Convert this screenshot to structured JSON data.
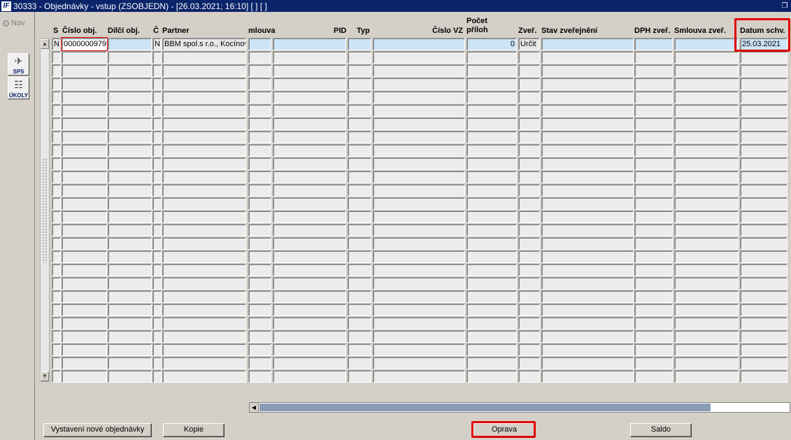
{
  "window": {
    "title": "30333 - Objednávky - vstup (ZSOBJEDN) - [26.03.2021; 16:10]  [ ]  [ ]",
    "app_icon": "IF"
  },
  "left": {
    "nav_label": "Nav",
    "tool_sps": "SPS",
    "tool_ukoly": "ÚKOLY"
  },
  "columns": {
    "s": "S",
    "cislo_obj": "Číslo obj.",
    "dilci_obj": "Dílčí obj.",
    "c": "Č",
    "partner": "Partner",
    "smlouva": "mlouva",
    "pid": "PID",
    "typ": "Typ",
    "cislo_vz": "Číslo VZ",
    "pocet_l1": "Počet",
    "pocet_l2": "příloh",
    "zver": "Zveř.",
    "stav": "Stav zveřejnění",
    "dph": "DPH zveř.",
    "smlouva_zver": "Smlouva zveř.",
    "datum": "Datum schv."
  },
  "row1": {
    "s": "N",
    "cislo_obj": "0000000979",
    "dilci_obj": "",
    "c": "N",
    "partner": "BBM spol.s r.o., Kocínov",
    "smlouva": "",
    "pid": "",
    "typ": "",
    "cislo_vz": "",
    "pocet": "0",
    "zver": "Určit",
    "stav": "",
    "dph": "",
    "smlouva_zver": "",
    "datum": "25.03.2021"
  },
  "buttons": {
    "nova": "Vystavení nové objednávky",
    "kopie": "Kopie",
    "oprava": "Oprava",
    "saldo": "Saldo"
  }
}
